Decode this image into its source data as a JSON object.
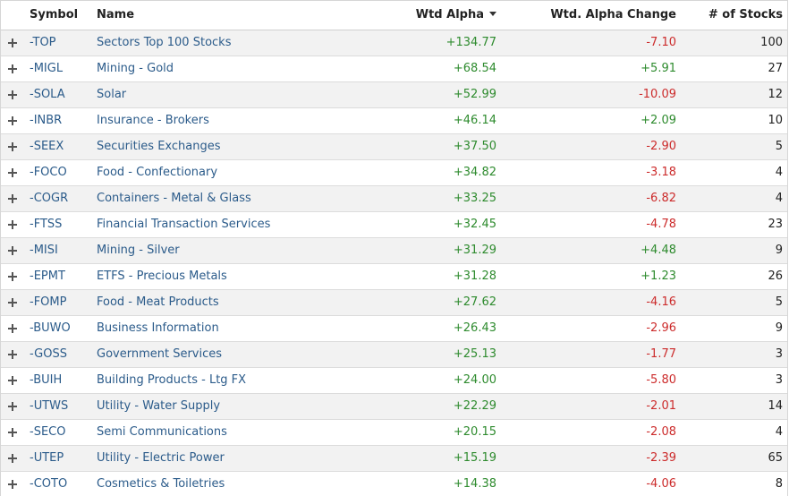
{
  "header": {
    "symbol": "Symbol",
    "name": "Name",
    "wtd_alpha": "Wtd Alpha",
    "alpha_change": "Wtd. Alpha Change",
    "num_stocks": "# of Stocks"
  },
  "colors": {
    "positive": "#2e8b2e",
    "negative": "#cc2b2b",
    "link": "#2b5b8a"
  },
  "rows": [
    {
      "symbol": "-TOP",
      "name": "Sectors Top 100 Stocks",
      "alpha": "+134.77",
      "change": "-7.10",
      "count": "100"
    },
    {
      "symbol": "-MIGL",
      "name": "Mining - Gold",
      "alpha": "+68.54",
      "change": "+5.91",
      "count": "27"
    },
    {
      "symbol": "-SOLA",
      "name": "Solar",
      "alpha": "+52.99",
      "change": "-10.09",
      "count": "12"
    },
    {
      "symbol": "-INBR",
      "name": "Insurance - Brokers",
      "alpha": "+46.14",
      "change": "+2.09",
      "count": "10"
    },
    {
      "symbol": "-SEEX",
      "name": "Securities Exchanges",
      "alpha": "+37.50",
      "change": "-2.90",
      "count": "5"
    },
    {
      "symbol": "-FOCO",
      "name": "Food - Confectionary",
      "alpha": "+34.82",
      "change": "-3.18",
      "count": "4"
    },
    {
      "symbol": "-COGR",
      "name": "Containers - Metal & Glass",
      "alpha": "+33.25",
      "change": "-6.82",
      "count": "4"
    },
    {
      "symbol": "-FTSS",
      "name": "Financial Transaction Services",
      "alpha": "+32.45",
      "change": "-4.78",
      "count": "23"
    },
    {
      "symbol": "-MISI",
      "name": "Mining - Silver",
      "alpha": "+31.29",
      "change": "+4.48",
      "count": "9"
    },
    {
      "symbol": "-EPMT",
      "name": "ETFS - Precious Metals",
      "alpha": "+31.28",
      "change": "+1.23",
      "count": "26"
    },
    {
      "symbol": "-FOMP",
      "name": "Food - Meat Products",
      "alpha": "+27.62",
      "change": "-4.16",
      "count": "5"
    },
    {
      "symbol": "-BUWO",
      "name": "Business Information",
      "alpha": "+26.43",
      "change": "-2.96",
      "count": "9"
    },
    {
      "symbol": "-GOSS",
      "name": "Government Services",
      "alpha": "+25.13",
      "change": "-1.77",
      "count": "3"
    },
    {
      "symbol": "-BUIH",
      "name": "Building Products - Ltg FX",
      "alpha": "+24.00",
      "change": "-5.80",
      "count": "3"
    },
    {
      "symbol": "-UTWS",
      "name": "Utility - Water Supply",
      "alpha": "+22.29",
      "change": "-2.01",
      "count": "14"
    },
    {
      "symbol": "-SECO",
      "name": "Semi Communications",
      "alpha": "+20.15",
      "change": "-2.08",
      "count": "4"
    },
    {
      "symbol": "-UTEP",
      "name": "Utility - Electric Power",
      "alpha": "+15.19",
      "change": "-2.39",
      "count": "65"
    },
    {
      "symbol": "-COTO",
      "name": "Cosmetics & Toiletries",
      "alpha": "+14.38",
      "change": "-4.06",
      "count": "8"
    }
  ]
}
